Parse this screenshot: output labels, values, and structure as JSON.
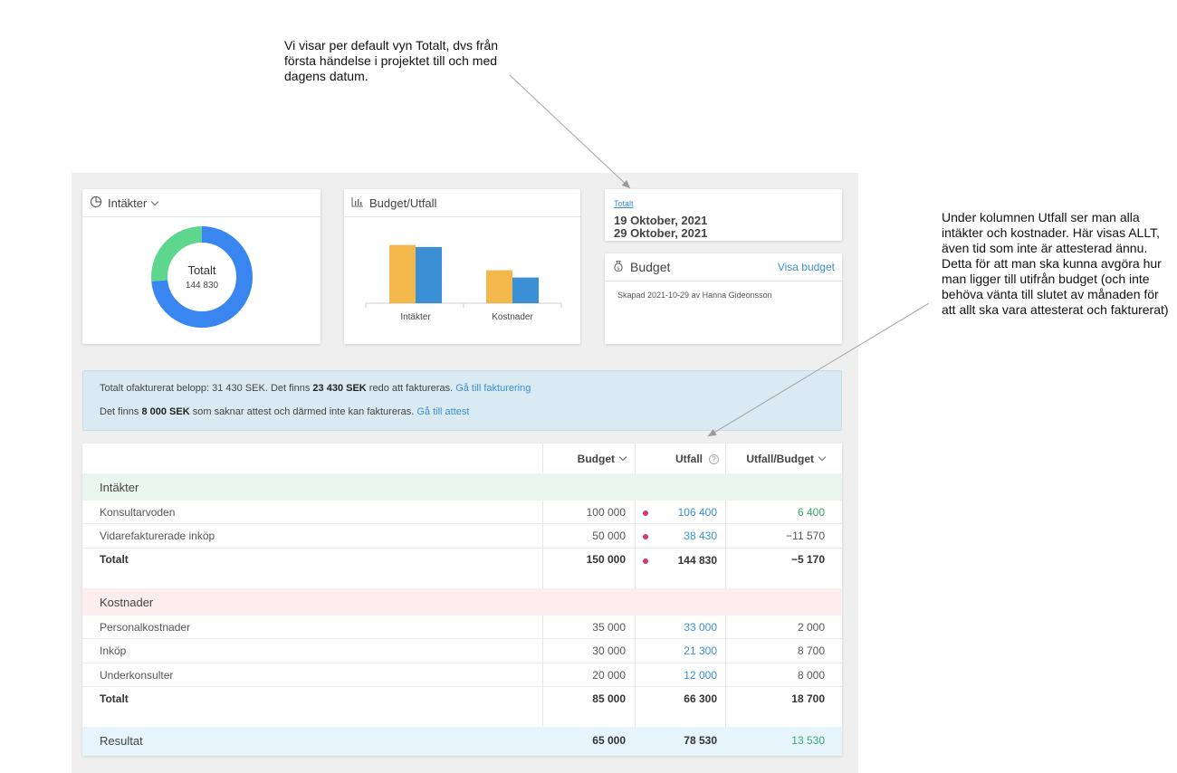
{
  "annotations": {
    "top": "Vi visar per default vyn Totalt, dvs från första händelse i projektet till och med dagens datum.",
    "right": "Under kolumnen Utfall ser man alla intäkter och kostnader. Här visas ALLT, även tid som inte är attesterad ännu. Detta för att man ska kunna avgöra hur man ligger till utifrån budget (och inte behöva vänta till slutet av månaden för att allt ska vara attesterat och fakturerat)"
  },
  "income_card": {
    "title": "Intäkter",
    "icon": "pie-chart-icon",
    "donut_label": "Totalt",
    "donut_value": "144 830",
    "donut_segments": [
      {
        "value": 106400,
        "color": "#3a86f0"
      },
      {
        "value": 38430,
        "color": "#5ed68e"
      }
    ]
  },
  "budget_chart_card": {
    "title": "Budget/Utfall",
    "icon": "bar-chart-icon",
    "chart_data": {
      "type": "bar",
      "categories": [
        "Intäkter",
        "Kostnader"
      ],
      "series": [
        {
          "values": [
            150000,
            85000
          ],
          "color": "#f2b84b"
        },
        {
          "values": [
            144830,
            66300
          ],
          "color": "#3b8fd4"
        }
      ],
      "ylim": [
        0,
        210000
      ]
    }
  },
  "period_card": {
    "link": "Totalt",
    "date_from": "19 Oktober, 2021",
    "date_to": "29 Oktober, 2021"
  },
  "budget_card": {
    "title": "Budget",
    "icon": "money-bag-icon",
    "link": "Visa budget",
    "created": "Skapad 2021-10-29 av Hanna Gideonsson"
  },
  "info": {
    "line1_pre": "Totalt ofakturerat belopp: 31 430 SEK. Det finns ",
    "line1_bold": "23 430 SEK",
    "line1_post": " redo att faktureras. ",
    "line1_link": "Gå till fakturering",
    "line2_pre": "Det finns ",
    "line2_bold": "8 000 SEK",
    "line2_post": " som saknar attest och därmed inte kan faktureras. ",
    "line2_link": "Gå till attest"
  },
  "table": {
    "headers": {
      "budget": "Budget",
      "utfall": "Utfall",
      "ratio": "Utfall/Budget"
    },
    "income": {
      "title": "Intäkter",
      "rows": [
        {
          "label": "Konsultarvoden",
          "budget": "100 000",
          "utfall": "106 400",
          "diff": "6 400"
        },
        {
          "label": "Vidarefakturerade inköp",
          "budget": "50 000",
          "utfall": "38 430",
          "diff": "−11 570"
        }
      ],
      "total": {
        "label": "Totalt",
        "budget": "150 000",
        "utfall": "144 830",
        "diff": "−5 170"
      }
    },
    "costs": {
      "title": "Kostnader",
      "rows": [
        {
          "label": "Personalkostnader",
          "budget": "35 000",
          "utfall": "33 000",
          "diff": "2 000"
        },
        {
          "label": "Inköp",
          "budget": "30 000",
          "utfall": "21 300",
          "diff": "8 700"
        },
        {
          "label": "Underkonsulter",
          "budget": "20 000",
          "utfall": "12 000",
          "diff": "8 000"
        }
      ],
      "total": {
        "label": "Totalt",
        "budget": "85 000",
        "utfall": "66 300",
        "diff": "18 700"
      }
    },
    "result": {
      "label": "Resultat",
      "budget": "65 000",
      "utfall": "78 530",
      "diff": "13 530"
    }
  },
  "colors": {
    "accent": "#3b8fd4",
    "positive": "#3aa76d",
    "dot": "#d13b6c",
    "income_bg": "#eaf5ef",
    "cost_bg": "#fdeeee",
    "result_bg": "#e6f4fc"
  }
}
